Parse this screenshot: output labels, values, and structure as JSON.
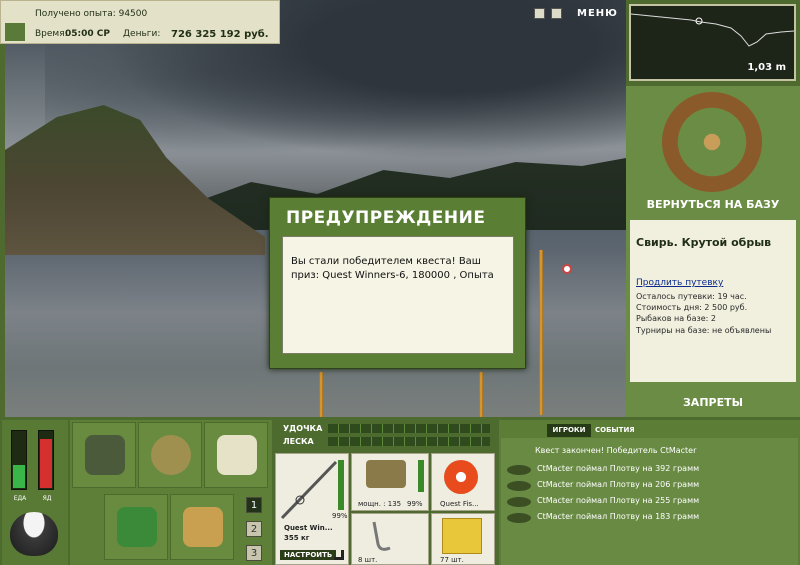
{
  "top": {
    "exp_text": "Получено опыта: 94500",
    "time_label": "Время:",
    "time_value": "05:00 СР",
    "money_label": "Деньги:",
    "money_value": "726 325 192 руб."
  },
  "menu": {
    "label": "МЕНЮ"
  },
  "depth": {
    "value": "1,03 m"
  },
  "right_panel": {
    "back_label": "ВЕРНУТЬСЯ НА БАЗУ",
    "location": "Свирь. Крутой обрыв",
    "extend_link": "Продлить путевку",
    "voucher_left": "Осталось путевки: 19 час.",
    "day_cost": "Стоимость дня: 2 500 руб.",
    "fishers": "Рыбаков на базе: 2",
    "tournaments": "Турниры на базе: не объявлены",
    "bans_label": "ЗАПРЕТЫ"
  },
  "dialog": {
    "title": "ПРЕДУПРЕЖДЕНИЕ",
    "message": "Вы стали победителем квеста! Ваш приз: Quest Winners-6, 180000 , Опыта"
  },
  "meters": {
    "food_label": "ЕДА",
    "poison_label": "ЯД",
    "food_level": 0.4,
    "poison_level": 0.85
  },
  "pages": [
    "1",
    "2",
    "3"
  ],
  "tackle": {
    "rod_label": "УДОЧКА",
    "line_label": "ЛЕСКА",
    "rod_name": "Quest Win...",
    "rod_weight": "355 кг",
    "rod_wear": "99%",
    "reel_power": "мощн. : 135",
    "reel_wear": "99%",
    "line_name": "Quest Fis...",
    "hook_count": "8 шт.",
    "bait_count": "77 шт.",
    "setup_button": "НАСТРОИТЬ"
  },
  "events": {
    "tab_players": "ИГРОКИ",
    "tab_events": "СОБЫТИЯ",
    "items": [
      "Квест закончен! Победитель CtMacter",
      "CtMacter поймал Плотву на 392 грамм",
      "CtMacter поймал Плотву на 206 грамм",
      "CtMacter поймал Плотву на 255 грамм",
      "CtMacter поймал Плотву на 183 грамм"
    ]
  },
  "colors": {
    "panel": "#4f6a2e",
    "meter_food": "#39b54a",
    "meter_poison": "#d62f2f"
  }
}
